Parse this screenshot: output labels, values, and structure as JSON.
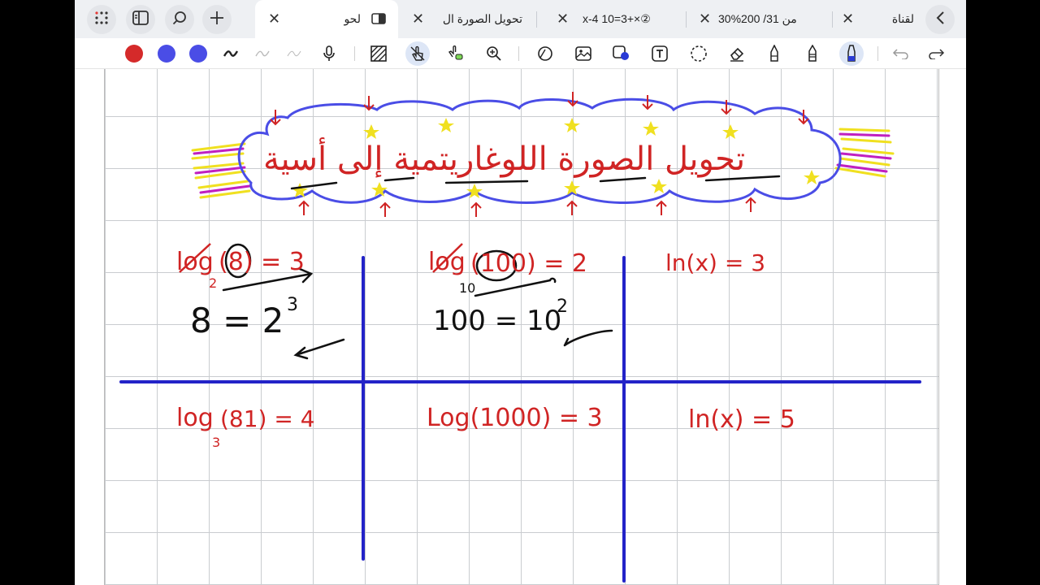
{
  "tabs": [
    {
      "label": "لقناة"
    },
    {
      "label": "30%من 31/ 200"
    },
    {
      "label": "x-4 10=3+×②"
    },
    {
      "label": "تحويل الصورة ال"
    },
    {
      "label": "لحو"
    }
  ],
  "colors": {
    "pen_red": "#d52a2a",
    "pen_blue_1": "#4a4de6",
    "pen_blue_2": "#4a4de6",
    "ink_red": "#d02424",
    "line_blue": "#2323c8"
  },
  "icons": {
    "apps": "apps-icon",
    "sidebar": "sidebar-icon",
    "search": "search-icon",
    "add": "plus-icon",
    "back": "chevron-left-icon"
  },
  "note": {
    "title": "تحويل الصورة اللوغاريتمية إلى أسية",
    "cells": {
      "c1_top_log": "log",
      "c1_top_paren": "(8) = 3",
      "c1_top_base": "2",
      "c1_top_eq_base": "8  = 2",
      "c1_top_eq_exp": "3",
      "c2_top_log": "log",
      "c2_top_paren": "(100) = 2",
      "c2_top_base": "10",
      "c2_top_eq_base": "100 = 10",
      "c2_top_eq_exp": "2",
      "c3_top": "ln(x) = 3",
      "c1_bot_log": "log",
      "c1_bot_paren": "(81) = 4",
      "c1_bot_base": "3",
      "c2_bot": "Log(1000) = 3",
      "c3_bot": "ln(x) = 5"
    }
  }
}
